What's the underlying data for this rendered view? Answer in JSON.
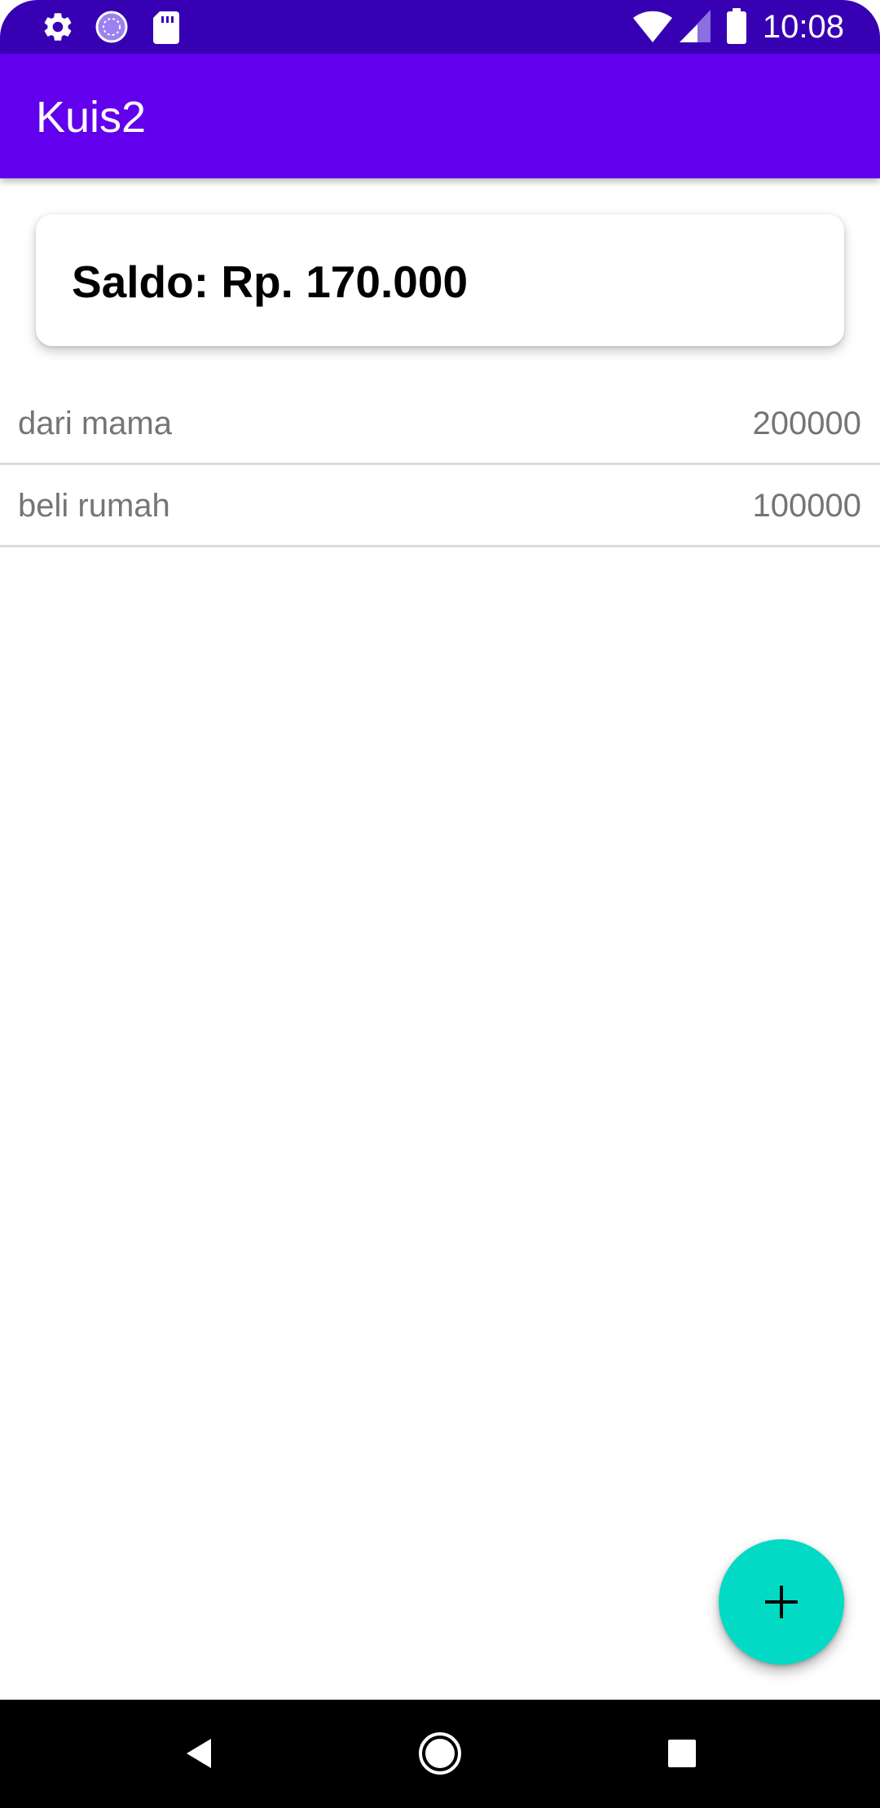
{
  "status_bar": {
    "time": "10:08",
    "left_icons": [
      "settings-icon",
      "sync-icon",
      "sd-card-icon"
    ],
    "right_icons": [
      "wifi-icon",
      "cell-signal-icon",
      "battery-icon"
    ],
    "background": "#3700B3"
  },
  "app_bar": {
    "title": "Kuis2",
    "background": "#6200EE"
  },
  "balance_card": {
    "text": "Saldo: Rp. 170.000"
  },
  "transactions": [
    {
      "description": "dari mama",
      "amount": "200000"
    },
    {
      "description": "beli rumah",
      "amount": "100000"
    }
  ],
  "fab": {
    "icon": "plus-icon",
    "color": "#03DAC5"
  },
  "nav_bar": {
    "buttons": [
      "back-icon",
      "home-icon",
      "recents-icon"
    ]
  }
}
